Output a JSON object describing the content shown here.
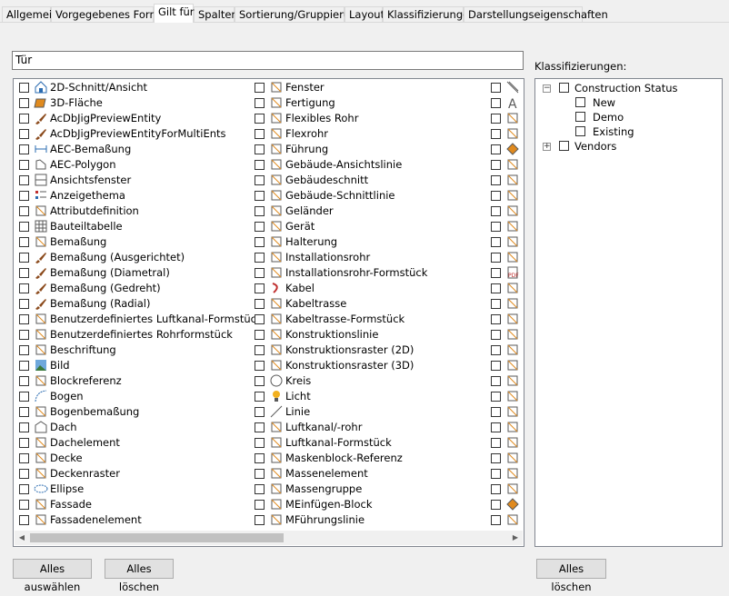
{
  "tabs": [
    {
      "label": "Allgemein"
    },
    {
      "label": "Vorgegebenes Format"
    },
    {
      "label": "Gilt für"
    },
    {
      "label": "Spalten"
    },
    {
      "label": "Sortierung/Gruppierung"
    },
    {
      "label": "Layout"
    },
    {
      "label": "Klassifizierungen"
    },
    {
      "label": "Darstellungseigenschaften"
    }
  ],
  "active_tab": "Gilt für",
  "filter": {
    "value": "Tür"
  },
  "objects": {
    "col1": [
      {
        "label": "2D-Schnitt/Ansicht",
        "icon": "house-section-icon"
      },
      {
        "label": "3D-Fläche",
        "icon": "3d-face-icon"
      },
      {
        "label": "AcDbJigPreviewEntity",
        "icon": "brush-icon"
      },
      {
        "label": "AcDbJigPreviewEntityForMultiEnts",
        "icon": "brush-icon"
      },
      {
        "label": "AEC-Bemaßung",
        "icon": "dimension-icon"
      },
      {
        "label": "AEC-Polygon",
        "icon": "polygon-icon"
      },
      {
        "label": "Ansichtsfenster",
        "icon": "viewport-icon"
      },
      {
        "label": "Anzeigethema",
        "icon": "display-theme-icon"
      },
      {
        "label": "Attributdefinition",
        "icon": "attribute-icon"
      },
      {
        "label": "Bauteiltabelle",
        "icon": "table-icon"
      },
      {
        "label": "Bemaßung",
        "icon": "dimension-pen-icon"
      },
      {
        "label": "Bemaßung (Ausgerichtet)",
        "icon": "brush-icon"
      },
      {
        "label": "Bemaßung (Diametral)",
        "icon": "brush-icon"
      },
      {
        "label": "Bemaßung (Gedreht)",
        "icon": "brush-icon"
      },
      {
        "label": "Bemaßung (Radial)",
        "icon": "brush-icon"
      },
      {
        "label": "Benutzerdefiniertes Luftkanal-Formstück",
        "icon": "duct-fitting-icon"
      },
      {
        "label": "Benutzerdefiniertes Rohrformstück",
        "icon": "pipe-fitting-icon"
      },
      {
        "label": "Beschriftung",
        "icon": "label-icon"
      },
      {
        "label": "Bild",
        "icon": "image-icon"
      },
      {
        "label": "Blockreferenz",
        "icon": "block-icon"
      },
      {
        "label": "Bogen",
        "icon": "arc-icon"
      },
      {
        "label": "Bogenbemaßung",
        "icon": "arc-dimension-icon"
      },
      {
        "label": "Dach",
        "icon": "roof-icon"
      },
      {
        "label": "Dachelement",
        "icon": "roof-slab-icon"
      },
      {
        "label": "Decke",
        "icon": "slab-icon"
      },
      {
        "label": "Deckenraster",
        "icon": "ceiling-grid-icon"
      },
      {
        "label": "Ellipse",
        "icon": "ellipse-icon"
      },
      {
        "label": "Fassade",
        "icon": "facade-icon"
      },
      {
        "label": "Fassadenelement",
        "icon": "facade-element-icon"
      }
    ],
    "col2": [
      {
        "label": "Fenster",
        "icon": "window-icon"
      },
      {
        "label": "Fertigung",
        "icon": "fabrication-icon"
      },
      {
        "label": "Flexibles Rohr",
        "icon": "flex-pipe-icon"
      },
      {
        "label": "Flexrohr",
        "icon": "flex-duct-icon"
      },
      {
        "label": "Führung",
        "icon": "leader-icon"
      },
      {
        "label": "Gebäude-Ansichtslinie",
        "icon": "elevation-line-icon"
      },
      {
        "label": "Gebäudeschnitt",
        "icon": "building-section-icon"
      },
      {
        "label": "Gebäude-Schnittlinie",
        "icon": "section-line-icon"
      },
      {
        "label": "Geländer",
        "icon": "railing-icon"
      },
      {
        "label": "Gerät",
        "icon": "device-icon"
      },
      {
        "label": "Halterung",
        "icon": "hanger-icon"
      },
      {
        "label": "Installationsrohr",
        "icon": "conduit-icon"
      },
      {
        "label": "Installationsrohr-Formstück",
        "icon": "conduit-fitting-icon"
      },
      {
        "label": "Kabel",
        "icon": "wire-icon"
      },
      {
        "label": "Kabeltrasse",
        "icon": "cable-tray-icon"
      },
      {
        "label": "Kabeltrasse-Formstück",
        "icon": "cable-tray-fitting-icon"
      },
      {
        "label": "Konstruktionslinie",
        "icon": "construction-line-icon"
      },
      {
        "label": "Konstruktionsraster (2D)",
        "icon": "grid-2d-icon"
      },
      {
        "label": "Konstruktionsraster (3D)",
        "icon": "grid-3d-icon"
      },
      {
        "label": "Kreis",
        "icon": "circle-icon"
      },
      {
        "label": "Licht",
        "icon": "light-bulb-icon"
      },
      {
        "label": "Linie",
        "icon": "line-icon"
      },
      {
        "label": "Luftkanal/-rohr",
        "icon": "duct-icon"
      },
      {
        "label": "Luftkanal-Formstück",
        "icon": "duct-fitting-icon"
      },
      {
        "label": "Maskenblock-Referenz",
        "icon": "mask-block-icon"
      },
      {
        "label": "Massenelement",
        "icon": "mass-element-icon"
      },
      {
        "label": "Massengruppe",
        "icon": "mass-group-icon"
      },
      {
        "label": "MEinfügen-Block",
        "icon": "minsert-icon"
      },
      {
        "label": "MFührungslinie",
        "icon": "mleader-icon"
      }
    ],
    "col3_icons": [
      "hatch-icon",
      "text-icon",
      "solid-icon",
      "box-icon",
      "diamond-icon",
      "member-icon",
      "wall-icon",
      "wedge-icon",
      "pipe-icon",
      "pipe-tee-icon",
      "schedule-icon",
      "stair-icon",
      "pdf-icon",
      "property-icon",
      "spline-icon",
      "dashed-icon",
      "polyline-icon",
      "points-icon",
      "panel-icon",
      "tag-icon",
      "bracket-icon",
      "pipe-bend-icon",
      "valve-icon",
      "pen-icon",
      "sheet-icon",
      "step-icon",
      "region-icon",
      "diamond-icon",
      "cube-icon"
    ]
  },
  "list_scrollbar": {
    "left_arrow": "◀",
    "right_arrow": "▶"
  },
  "classifications_label": "Klassifizierungen:",
  "tree": [
    {
      "label": "Construction Status",
      "expander": "−",
      "children": [
        {
          "label": "New"
        },
        {
          "label": "Demo"
        },
        {
          "label": "Existing"
        }
      ]
    },
    {
      "label": "Vendors",
      "expander": "+"
    }
  ],
  "buttons": {
    "select_all": "Alles auswählen",
    "clear_all": "Alles löschen",
    "clear_classifications": "Alles löschen"
  },
  "colors": {
    "accent_orange": "#e08a1e",
    "icon_gray": "#5a5a5a",
    "brush_brown": "#8b4a1c"
  }
}
